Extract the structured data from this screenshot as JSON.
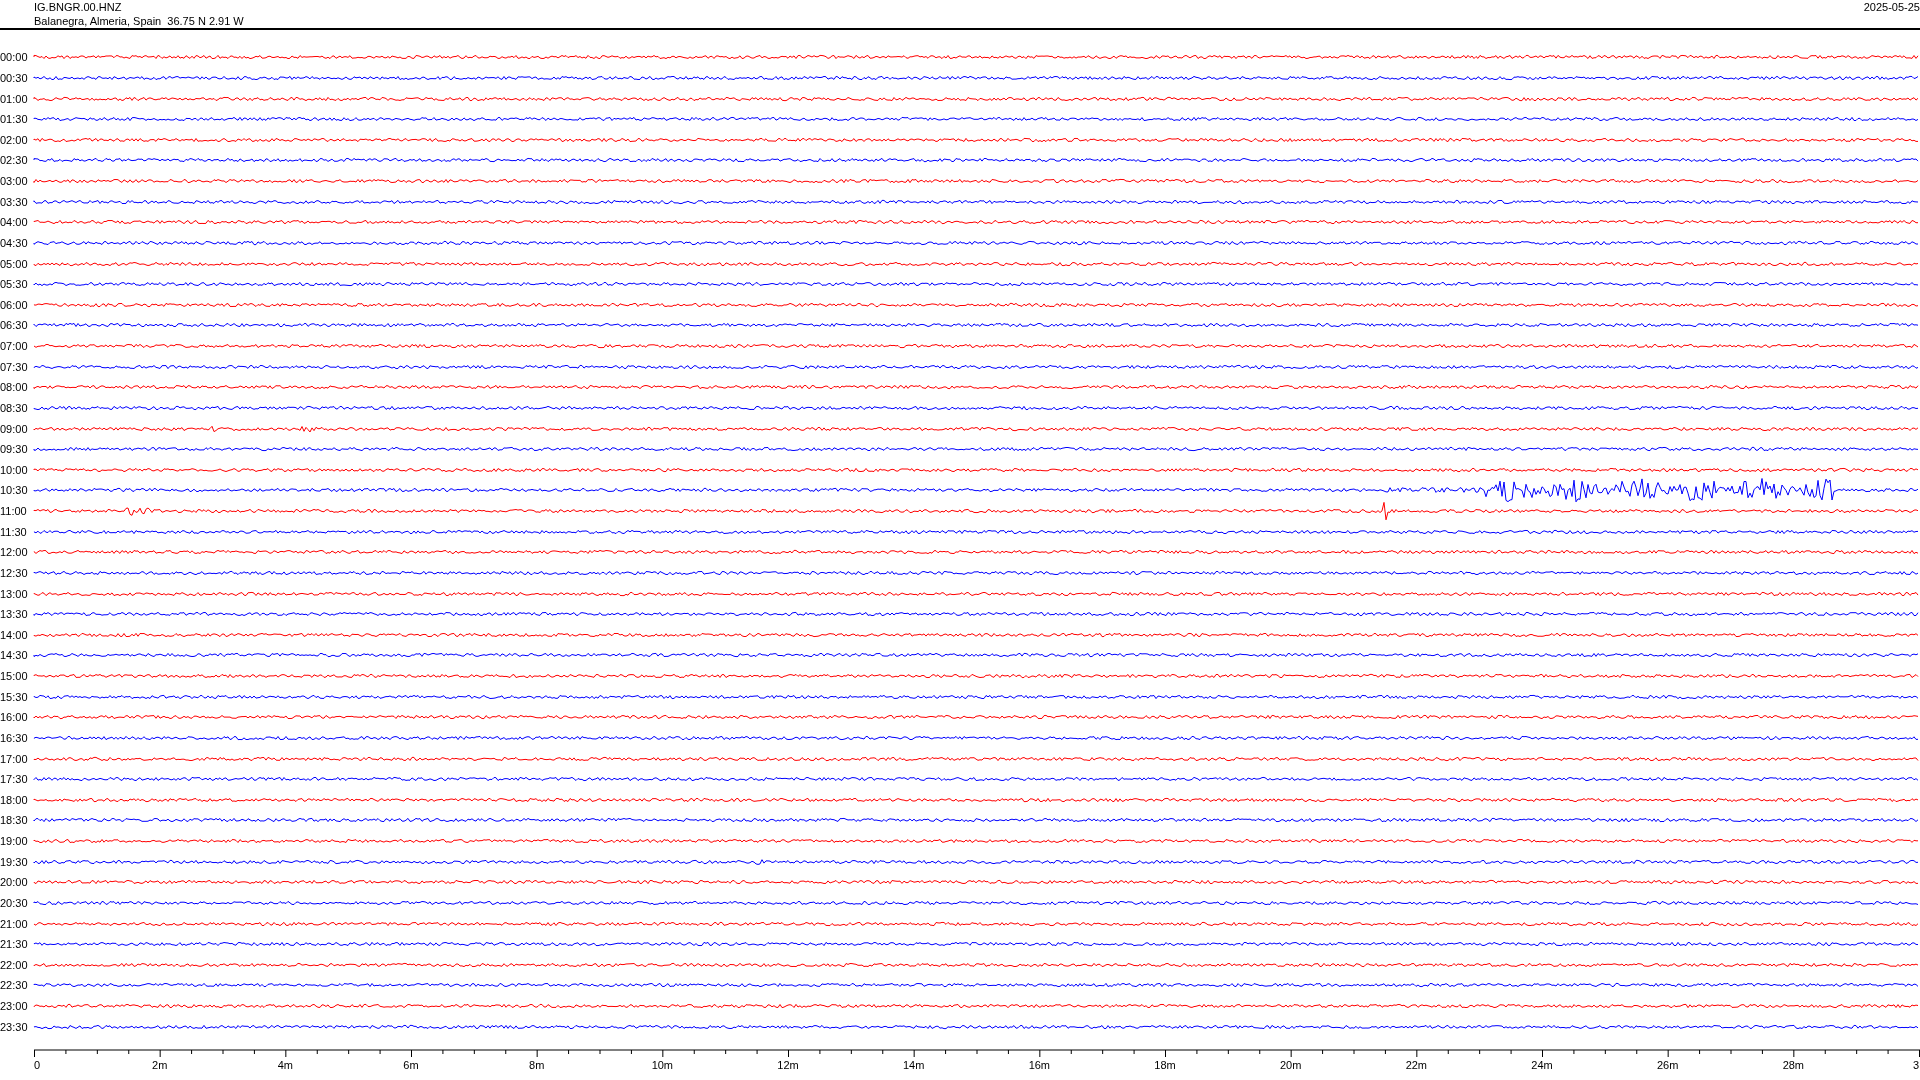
{
  "header": {
    "station": "IG.BNGR.00.HNZ",
    "location": "Balanegra, Almeria, Spain  36.75 N 2.91 W",
    "date": "2025-05-25"
  },
  "rows": [
    {
      "time": "00:00",
      "color": "#ff0000"
    },
    {
      "time": "00:30",
      "color": "#0000ff"
    },
    {
      "time": "01:00",
      "color": "#ff0000"
    },
    {
      "time": "01:30",
      "color": "#0000ff"
    },
    {
      "time": "02:00",
      "color": "#ff0000"
    },
    {
      "time": "02:30",
      "color": "#0000ff"
    },
    {
      "time": "03:00",
      "color": "#ff0000"
    },
    {
      "time": "03:30",
      "color": "#0000ff"
    },
    {
      "time": "04:00",
      "color": "#ff0000"
    },
    {
      "time": "04:30",
      "color": "#0000ff"
    },
    {
      "time": "05:00",
      "color": "#ff0000"
    },
    {
      "time": "05:30",
      "color": "#0000ff"
    },
    {
      "time": "06:00",
      "color": "#ff0000"
    },
    {
      "time": "06:30",
      "color": "#0000ff"
    },
    {
      "time": "07:00",
      "color": "#ff0000"
    },
    {
      "time": "07:30",
      "color": "#0000ff"
    },
    {
      "time": "08:00",
      "color": "#ff0000"
    },
    {
      "time": "08:30",
      "color": "#0000ff"
    },
    {
      "time": "09:00",
      "color": "#ff0000"
    },
    {
      "time": "09:30",
      "color": "#0000ff"
    },
    {
      "time": "10:00",
      "color": "#ff0000"
    },
    {
      "time": "10:30",
      "color": "#0000ff"
    },
    {
      "time": "11:00",
      "color": "#ff0000"
    },
    {
      "time": "11:30",
      "color": "#0000ff"
    },
    {
      "time": "12:00",
      "color": "#ff0000"
    },
    {
      "time": "12:30",
      "color": "#0000ff"
    },
    {
      "time": "13:00",
      "color": "#ff0000"
    },
    {
      "time": "13:30",
      "color": "#0000ff"
    },
    {
      "time": "14:00",
      "color": "#ff0000"
    },
    {
      "time": "14:30",
      "color": "#0000ff"
    },
    {
      "time": "15:00",
      "color": "#ff0000"
    },
    {
      "time": "15:30",
      "color": "#0000ff"
    },
    {
      "time": "16:00",
      "color": "#ff0000"
    },
    {
      "time": "16:30",
      "color": "#0000ff"
    },
    {
      "time": "17:00",
      "color": "#ff0000"
    },
    {
      "time": "17:30",
      "color": "#0000ff"
    },
    {
      "time": "18:00",
      "color": "#ff0000"
    },
    {
      "time": "18:30",
      "color": "#0000ff"
    },
    {
      "time": "19:00",
      "color": "#ff0000"
    },
    {
      "time": "19:30",
      "color": "#0000ff"
    },
    {
      "time": "20:00",
      "color": "#ff0000"
    },
    {
      "time": "20:30",
      "color": "#0000ff"
    },
    {
      "time": "21:00",
      "color": "#ff0000"
    },
    {
      "time": "21:30",
      "color": "#0000ff"
    },
    {
      "time": "22:00",
      "color": "#ff0000"
    },
    {
      "time": "22:30",
      "color": "#0000ff"
    },
    {
      "time": "23:00",
      "color": "#ff0000"
    },
    {
      "time": "23:30",
      "color": "#0000ff"
    }
  ],
  "x_axis": {
    "labels": [
      "0",
      "2m",
      "4m",
      "6m",
      "8m",
      "10m",
      "12m",
      "14m",
      "16m",
      "18m",
      "20m",
      "22m",
      "24m",
      "26m",
      "28m",
      "3"
    ]
  }
}
